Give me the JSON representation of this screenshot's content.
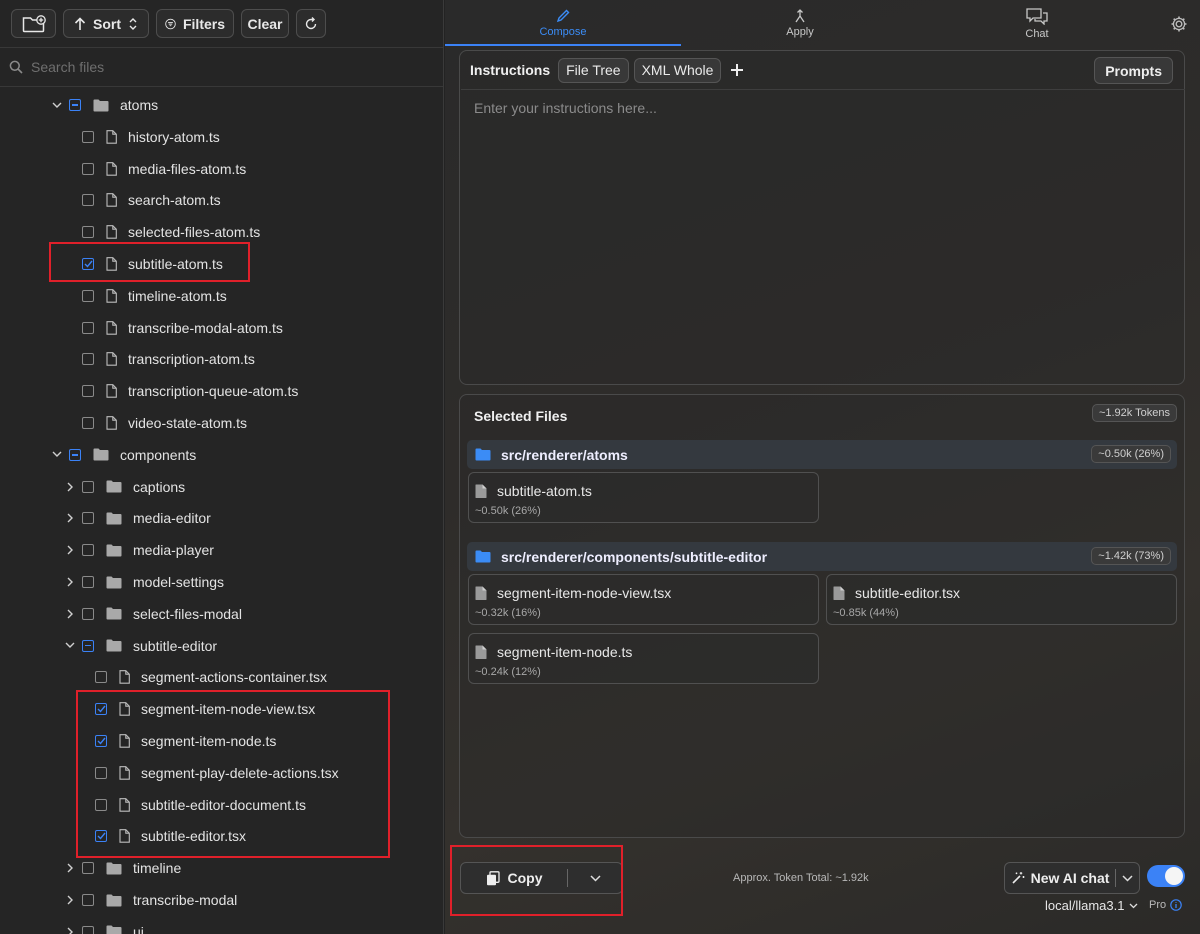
{
  "toolbar": {
    "sort_label": "Sort",
    "filters_label": "Filters",
    "clear_label": "Clear"
  },
  "search": {
    "placeholder": "Search files"
  },
  "tree": [
    {
      "label": "atoms",
      "type": "folder",
      "depth": 0,
      "expanded": true,
      "state": "mixed"
    },
    {
      "label": "history-atom.ts",
      "type": "file",
      "depth": 1,
      "state": "unchecked"
    },
    {
      "label": "media-files-atom.ts",
      "type": "file",
      "depth": 1,
      "state": "unchecked"
    },
    {
      "label": "search-atom.ts",
      "type": "file",
      "depth": 1,
      "state": "unchecked"
    },
    {
      "label": "selected-files-atom.ts",
      "type": "file",
      "depth": 1,
      "state": "unchecked"
    },
    {
      "label": "subtitle-atom.ts",
      "type": "file",
      "depth": 1,
      "state": "checked"
    },
    {
      "label": "timeline-atom.ts",
      "type": "file",
      "depth": 1,
      "state": "unchecked"
    },
    {
      "label": "transcribe-modal-atom.ts",
      "type": "file",
      "depth": 1,
      "state": "unchecked"
    },
    {
      "label": "transcription-atom.ts",
      "type": "file",
      "depth": 1,
      "state": "unchecked"
    },
    {
      "label": "transcription-queue-atom.ts",
      "type": "file",
      "depth": 1,
      "state": "unchecked"
    },
    {
      "label": "video-state-atom.ts",
      "type": "file",
      "depth": 1,
      "state": "unchecked"
    },
    {
      "label": "components",
      "type": "folder",
      "depth": 0,
      "expanded": true,
      "state": "mixed"
    },
    {
      "label": "captions",
      "type": "folder",
      "depth": 1,
      "expanded": false,
      "state": "unchecked"
    },
    {
      "label": "media-editor",
      "type": "folder",
      "depth": 1,
      "expanded": false,
      "state": "unchecked"
    },
    {
      "label": "media-player",
      "type": "folder",
      "depth": 1,
      "expanded": false,
      "state": "unchecked"
    },
    {
      "label": "model-settings",
      "type": "folder",
      "depth": 1,
      "expanded": false,
      "state": "unchecked"
    },
    {
      "label": "select-files-modal",
      "type": "folder",
      "depth": 1,
      "expanded": false,
      "state": "unchecked"
    },
    {
      "label": "subtitle-editor",
      "type": "folder",
      "depth": 1,
      "expanded": true,
      "state": "mixed"
    },
    {
      "label": "segment-actions-container.tsx",
      "type": "file",
      "depth": 2,
      "state": "unchecked"
    },
    {
      "label": "segment-item-node-view.tsx",
      "type": "file",
      "depth": 2,
      "state": "checked"
    },
    {
      "label": "segment-item-node.ts",
      "type": "file",
      "depth": 2,
      "state": "checked"
    },
    {
      "label": "segment-play-delete-actions.tsx",
      "type": "file",
      "depth": 2,
      "state": "unchecked"
    },
    {
      "label": "subtitle-editor-document.ts",
      "type": "file",
      "depth": 2,
      "state": "unchecked"
    },
    {
      "label": "subtitle-editor.tsx",
      "type": "file",
      "depth": 2,
      "state": "checked"
    },
    {
      "label": "timeline",
      "type": "folder",
      "depth": 1,
      "expanded": false,
      "state": "unchecked"
    },
    {
      "label": "transcribe-modal",
      "type": "folder",
      "depth": 1,
      "expanded": false,
      "state": "unchecked"
    },
    {
      "label": "ui",
      "type": "folder",
      "depth": 1,
      "expanded": false,
      "state": "unchecked"
    }
  ],
  "tabs": [
    {
      "label": "Compose",
      "icon": "pencil-icon",
      "active": true
    },
    {
      "label": "Apply",
      "icon": "merge-icon",
      "active": false
    },
    {
      "label": "Chat",
      "icon": "chat-bubbles-icon",
      "active": false
    }
  ],
  "instructions": {
    "label": "Instructions",
    "chips": [
      "File Tree",
      "XML Whole"
    ],
    "prompts_label": "Prompts",
    "placeholder": "Enter your instructions here..."
  },
  "selected_files": {
    "title": "Selected Files",
    "total_badge": "~1.92k Tokens",
    "groups": [
      {
        "path": "src/renderer/atoms",
        "badge": "~0.50k (26%)",
        "files": [
          {
            "name": "subtitle-atom.ts",
            "tokens": "~0.50k (26%)"
          }
        ]
      },
      {
        "path": "src/renderer/components/subtitle-editor",
        "badge": "~1.42k (73%)",
        "files": [
          {
            "name": "segment-item-node-view.tsx",
            "tokens": "~0.32k (16%)"
          },
          {
            "name": "subtitle-editor.tsx",
            "tokens": "~0.85k (44%)"
          },
          {
            "name": "segment-item-node.ts",
            "tokens": "~0.24k (12%)"
          }
        ]
      }
    ]
  },
  "bottom": {
    "copy_label": "Copy",
    "token_total": "Approx. Token Total: ~1.92k",
    "new_chat_label": "New AI chat",
    "model": "local/llama3.1",
    "pro_label": "Pro",
    "toggle_on": true
  },
  "colors": {
    "accent": "#3b82f6",
    "highlight": "#e0202a",
    "folder": "#3b8cf6"
  }
}
